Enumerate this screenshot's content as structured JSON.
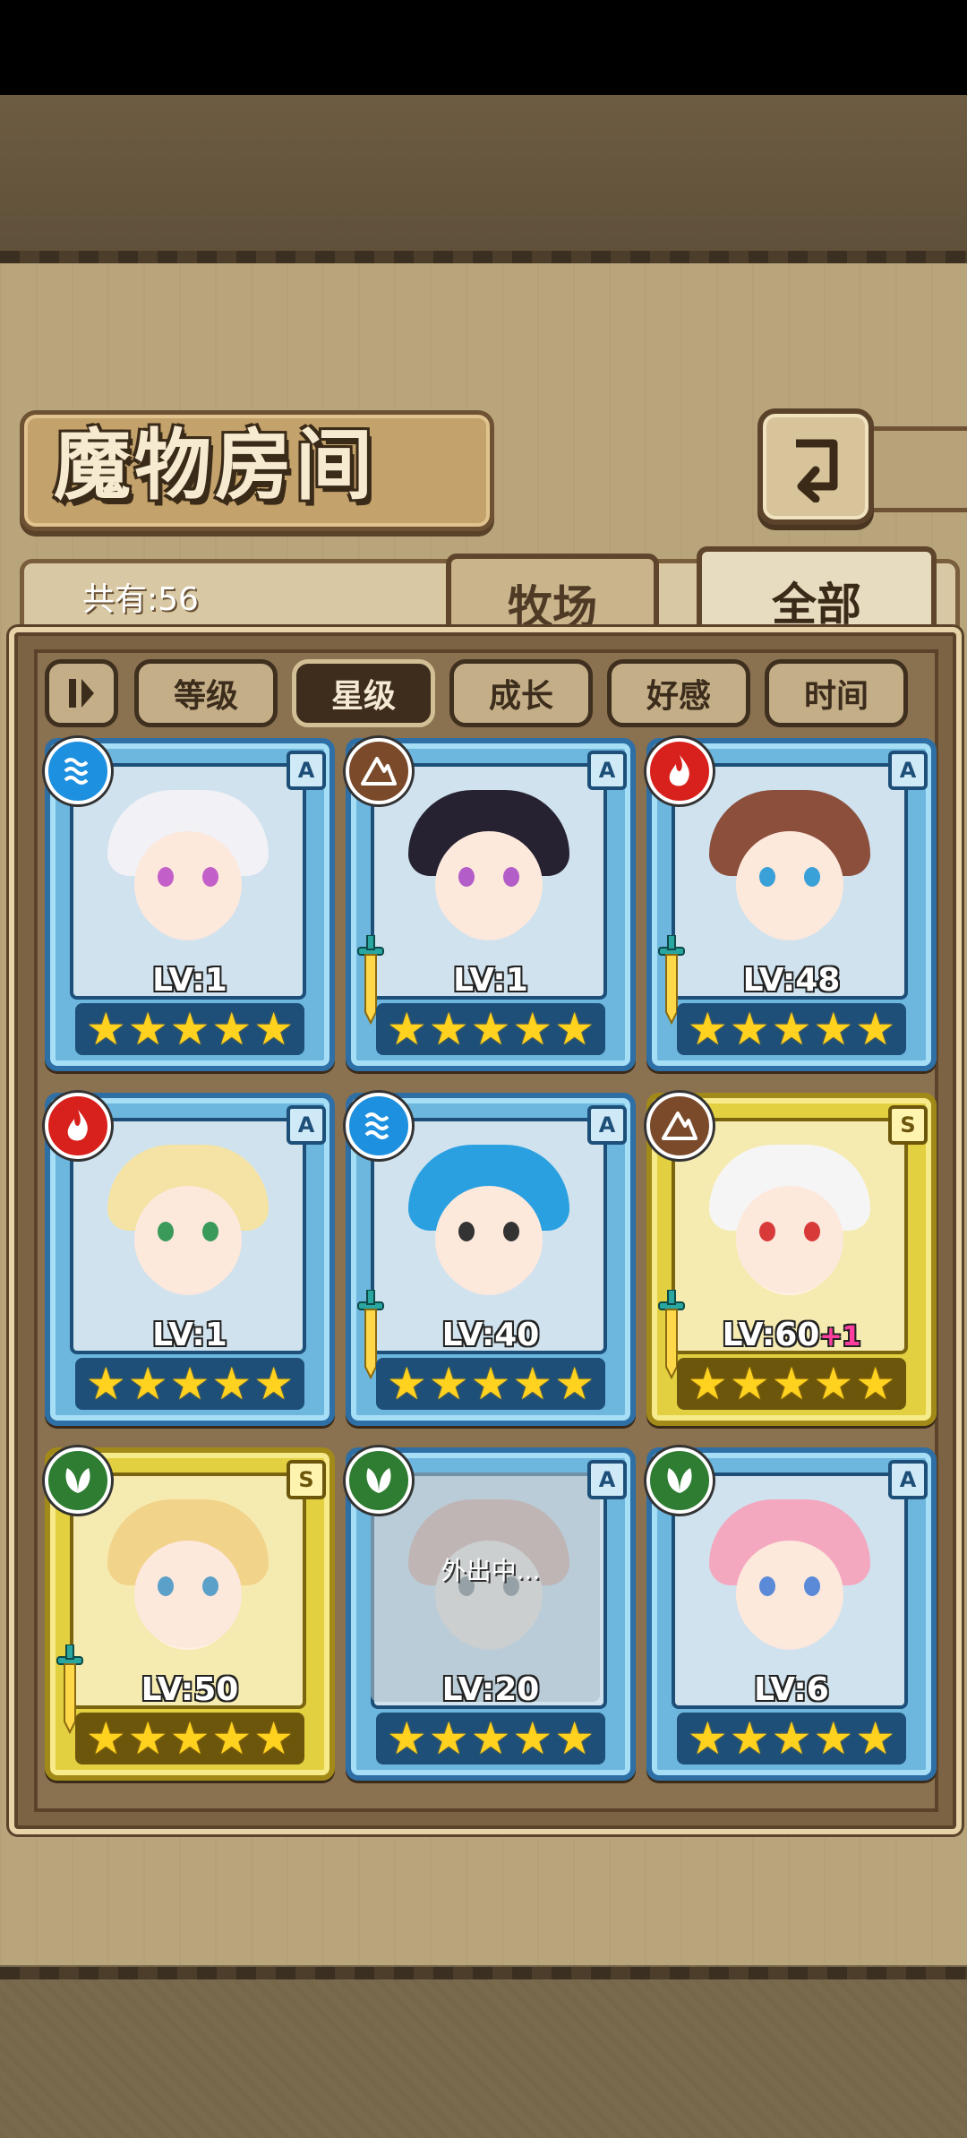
{
  "title": "魔物房间",
  "count_label": "共有:56",
  "tabs": [
    {
      "label": "牧场",
      "active": false
    },
    {
      "label": "全部",
      "active": true
    }
  ],
  "sort_options": [
    {
      "label": "等级",
      "active": false
    },
    {
      "label": "星级",
      "active": true
    },
    {
      "label": "成长",
      "active": false
    },
    {
      "label": "好感",
      "active": false
    },
    {
      "label": "时间",
      "active": false
    }
  ],
  "monsters": [
    {
      "element": "water",
      "rank": "A",
      "level": "LV:1",
      "stars": 5,
      "frame": "blue",
      "sword": false,
      "hair": "#f1f1f6",
      "eye": "#c25fc8"
    },
    {
      "element": "earth",
      "rank": "A",
      "level": "LV:1",
      "stars": 5,
      "frame": "blue",
      "sword": true,
      "hair": "#262231",
      "eye": "#b25dc8"
    },
    {
      "element": "fire",
      "rank": "A",
      "level": "LV:48",
      "stars": 5,
      "frame": "blue",
      "sword": true,
      "hair": "#8b4f3c",
      "eye": "#3aa0d8"
    },
    {
      "element": "fire",
      "rank": "A",
      "level": "LV:1",
      "stars": 5,
      "frame": "blue",
      "sword": false,
      "hair": "#f4e3a4",
      "eye": "#3a9a5a"
    },
    {
      "element": "water",
      "rank": "A",
      "level": "LV:40",
      "stars": 5,
      "frame": "blue",
      "sword": true,
      "hair": "#2aa0e0",
      "eye": "#333333"
    },
    {
      "element": "earth",
      "rank": "S",
      "level": "LV:60",
      "level_bonus": "+1",
      "stars": 5,
      "frame": "gold",
      "sword": true,
      "hair": "#f5f5f5",
      "eye": "#d83a3a"
    },
    {
      "element": "wood",
      "rank": "S",
      "level": "LV:50",
      "stars": 5,
      "frame": "gold",
      "sword": true,
      "hair": "#f2d38a",
      "eye": "#5aa0c8"
    },
    {
      "element": "wood",
      "rank": "A",
      "level": "LV:20",
      "stars": 5,
      "frame": "blue",
      "sword": false,
      "hair": "#e0a89a",
      "eye": "#777777",
      "status": "外出中..."
    },
    {
      "element": "wood",
      "rank": "A",
      "level": "LV:6",
      "stars": 5,
      "frame": "blue",
      "sword": false,
      "hair": "#f4a8c0",
      "eye": "#5a8ad8"
    }
  ],
  "colors": {
    "water": "#1e90e0",
    "earth": "#7a4a2a",
    "fire": "#d8201c",
    "wood": "#2e7d32"
  }
}
